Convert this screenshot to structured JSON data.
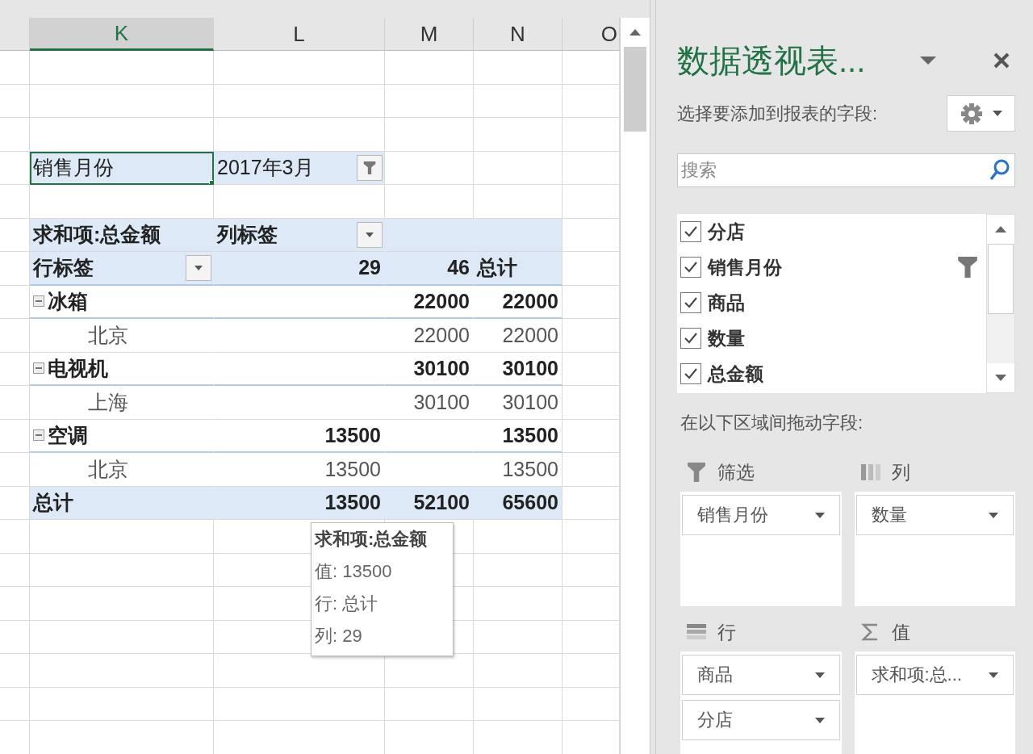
{
  "sheet": {
    "columns": [
      {
        "label": "K",
        "selected": true
      },
      {
        "label": "L",
        "selected": false
      },
      {
        "label": "M",
        "selected": false
      },
      {
        "label": "N",
        "selected": false
      },
      {
        "label": "O",
        "selected": false
      }
    ],
    "rows": [
      {
        "kind": "blank"
      },
      {
        "kind": "blank"
      },
      {
        "kind": "blank"
      },
      {
        "kind": "filter",
        "field": "销售月份",
        "field_selected": true,
        "value": "2017年3月",
        "filtered": true
      },
      {
        "kind": "blank"
      },
      {
        "kind": "pivot_title",
        "label": "求和项:总金额",
        "column_label": "列标签"
      },
      {
        "kind": "column_header",
        "label": "行标签",
        "cells": {
          "L": "29",
          "M": "46",
          "N": "总计"
        }
      },
      {
        "kind": "group",
        "label": "冰箱",
        "expanded": true,
        "cells": {
          "M": "22000",
          "N": "22000"
        }
      },
      {
        "kind": "item",
        "label": "北京",
        "cells": {
          "M": "22000",
          "N": "22000"
        }
      },
      {
        "kind": "group",
        "label": "电视机",
        "expanded": true,
        "cells": {
          "M": "30100",
          "N": "30100"
        }
      },
      {
        "kind": "item",
        "label": "上海",
        "cells": {
          "M": "30100",
          "N": "30100"
        }
      },
      {
        "kind": "group",
        "label": "空调",
        "expanded": true,
        "cells": {
          "L": "13500",
          "N": "13500"
        }
      },
      {
        "kind": "item",
        "label": "北京",
        "cells": {
          "L": "13500",
          "N": "13500"
        }
      },
      {
        "kind": "total",
        "label": "总计",
        "cells": {
          "L": "13500",
          "M": "52100",
          "N": "65600"
        }
      },
      {
        "kind": "blank"
      },
      {
        "kind": "blank"
      },
      {
        "kind": "blank"
      },
      {
        "kind": "blank"
      },
      {
        "kind": "blank"
      },
      {
        "kind": "blank"
      },
      {
        "kind": "blank"
      }
    ],
    "tooltip": {
      "title": "求和项:总金额",
      "lines": [
        "值: 13500",
        "行: 总计",
        "列: 29"
      ]
    }
  },
  "pane": {
    "title": "数据透视表...",
    "prompt": "选择要添加到报表的字段:",
    "search": {
      "placeholder": "搜索"
    },
    "fields": [
      {
        "label": "分店",
        "checked": true,
        "filtered": false
      },
      {
        "label": "销售月份",
        "checked": true,
        "filtered": true
      },
      {
        "label": "商品",
        "checked": true,
        "filtered": false
      },
      {
        "label": "数量",
        "checked": true,
        "filtered": false
      },
      {
        "label": "总金额",
        "checked": true,
        "filtered": false
      }
    ],
    "drag_hint": "在以下区域间拖动字段:",
    "areas": [
      {
        "kind": "filters",
        "label": "筛选",
        "items": [
          "销售月份"
        ]
      },
      {
        "kind": "columns",
        "label": "列",
        "items": [
          "数量"
        ]
      },
      {
        "kind": "rows",
        "label": "行",
        "items": [
          "商品",
          "分店"
        ]
      },
      {
        "kind": "values",
        "label": "值",
        "items": [
          "求和项:总..."
        ]
      }
    ]
  }
}
